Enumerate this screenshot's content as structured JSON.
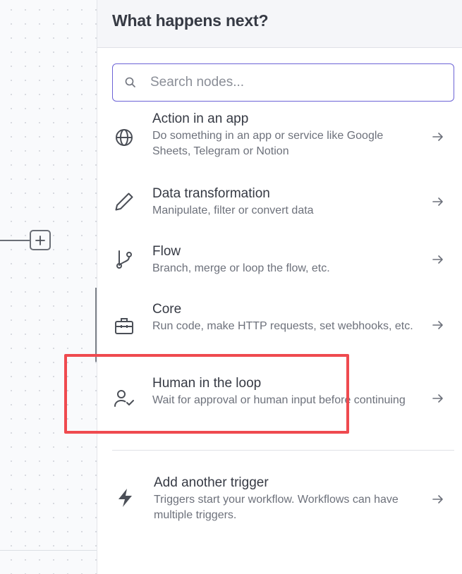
{
  "panel": {
    "title": "What happens next?"
  },
  "search": {
    "placeholder": "Search nodes..."
  },
  "items": [
    {
      "title": "Action in an app",
      "description": "Do something in an app or service like Google Sheets, Telegram or Notion",
      "icon": "globe-icon"
    },
    {
      "title": "Data transformation",
      "description": "Manipulate, filter or convert data",
      "icon": "pencil-icon"
    },
    {
      "title": "Flow",
      "description": "Branch, merge or loop the flow, etc.",
      "icon": "branch-icon"
    },
    {
      "title": "Core",
      "description": "Run code, make HTTP requests, set webhooks, etc.",
      "icon": "toolbox-icon"
    },
    {
      "title": "Human in the loop",
      "description": "Wait for approval or human input before continuing",
      "icon": "user-check-icon"
    }
  ],
  "trigger": {
    "title": "Add another trigger",
    "description": "Triggers start your workflow. Workflows can have multiple triggers.",
    "icon": "lightning-icon"
  },
  "colors": {
    "accent": "#6c63d6",
    "highlight": "#ef4a4f",
    "text_primary": "#363a44",
    "text_secondary": "#6d717b"
  }
}
